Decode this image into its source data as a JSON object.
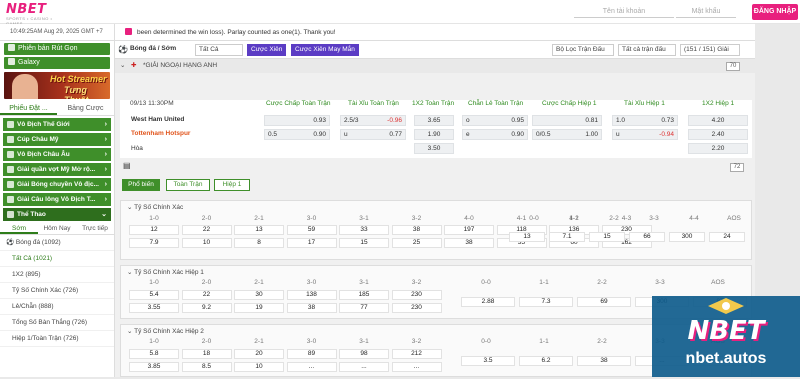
{
  "brand": {
    "logo": "NBET",
    "logo_sub": "SPORTS • CASINO • GAMES",
    "accent": "#e8207e",
    "green": "#3f8f2a"
  },
  "header": {
    "username_placeholder": "Tên tài khoản",
    "password_placeholder": "Mật khẩu",
    "login_label": "ĐĂNG NHẬP"
  },
  "sidebar": {
    "datetime": "10:49:25AM Aug 29, 2025 GMT +7",
    "buttons": [
      "Phiên bản Rút Gọn",
      "Galaxy"
    ],
    "banner": {
      "line1": "Hot Streamer",
      "line2": "Tưng Thuật"
    },
    "tabs": [
      "Phiếu Đặt ...",
      "Bảng Cược"
    ],
    "leagues": [
      "Vô Địch Thế Giới",
      "Cúp Châu Mỹ",
      "Vô Địch Châu Âu",
      "Giải quần vợt Mỹ Mở rộ...",
      "Giải Bóng chuyền Vô địc...",
      "Giải Câu lông Vô Địch T..."
    ],
    "sports_header": "Thể Thao",
    "subtabs": [
      "Sớm",
      "Hôm Nay",
      "Trực tiếp"
    ],
    "list": [
      {
        "label": "Bóng đá (1092)"
      },
      {
        "label": "Tất Cả (1021)"
      },
      {
        "label": "1X2 (895)"
      },
      {
        "label": "Tỷ Số Chính Xác (726)"
      },
      {
        "label": "Lẻ/Chẵn (888)"
      },
      {
        "label": "Tổng Số Bàn Thắng (726)"
      },
      {
        "label": "Hiệp 1/Toàn Trận (726)"
      }
    ]
  },
  "main": {
    "marquee": "been determined the win loss). Parlay counted as one(1). Thank you!",
    "filters": {
      "sport": "Bóng đá / Sớm",
      "all": "Tất Cả",
      "parlay": "Cược Xiên",
      "lucky": "Cược Xiên May Mắn",
      "league_filter": "Bộ Lọc Trận Đấu",
      "all_matches": "Tất cả trận đấu",
      "count": "(151 / 151) Giải"
    },
    "league": "*GIẢI NGOẠI HẠNG ANH",
    "league_badge": "70",
    "match": {
      "time": "09/13 11:30PM",
      "home": "West Ham United",
      "away": "Tottenham Hotspur",
      "draw": "Hòa",
      "headers": [
        "Cược Chấp Toàn Trận",
        "Tài Xỉu Toàn Trận",
        "1X2 Toàn Trận",
        "Chẵn Lẻ Toàn Trận",
        "Cược Chấp Hiệp 1",
        "Tài Xỉu Hiệp 1",
        "1X2 Hiệp 1"
      ],
      "hdp": [
        {
          "h": "",
          "o": "0.93"
        },
        {
          "h": "0.5",
          "o": "0.90"
        }
      ],
      "ou": [
        {
          "h": "2.5/3",
          "o": "-0.96"
        },
        {
          "h": "u",
          "o": "0.77"
        }
      ],
      "x12": [
        "3.65",
        "1.90",
        "3.50"
      ],
      "oe": [
        {
          "h": "o",
          "o": "0.95"
        },
        {
          "h": "e",
          "o": "0.90"
        }
      ],
      "hdp1": [
        {
          "h": "",
          "o": "0.81"
        },
        {
          "h": "0/0.5",
          "o": "1.00"
        }
      ],
      "ou1": [
        {
          "h": "1.0",
          "o": "0.73"
        },
        {
          "h": "u",
          "o": "-0.94"
        }
      ],
      "x12h1": [
        "4.20",
        "2.40",
        "2.20"
      ]
    },
    "more_badge": "72",
    "tabs": [
      "Phổ biến",
      "Toàn Trận",
      "Hiệp 1"
    ],
    "cs_full": {
      "title": "Tỷ Số Chính Xác",
      "home_heads": [
        "1-0",
        "2-0",
        "2-1",
        "3-0",
        "3-1",
        "3-2",
        "4-0",
        "4-1",
        "4-2",
        "4-3"
      ],
      "home_top": [
        "12",
        "22",
        "13",
        "59",
        "33",
        "38",
        "197",
        "118",
        "136",
        "230"
      ],
      "home_bot": [
        "7.9",
        "10",
        "8",
        "17",
        "15",
        "25",
        "38",
        "35",
        "60",
        "162"
      ],
      "draw_heads": [
        "0-0",
        "1-1",
        "2-2",
        "3-3",
        "4-4",
        "AOS"
      ],
      "draw_vals": [
        "13",
        "7.1",
        "15",
        "66",
        "300",
        "24"
      ]
    },
    "cs_h1": {
      "title": "Tỷ Số Chính Xác Hiệp 1",
      "home_heads": [
        "1-0",
        "2-0",
        "2-1",
        "3-0",
        "3-1",
        "3-2"
      ],
      "home_top": [
        "5.4",
        "22",
        "30",
        "138",
        "185",
        "230"
      ],
      "home_bot": [
        "3.55",
        "9.2",
        "19",
        "38",
        "77",
        "230"
      ],
      "draw_heads": [
        "0-0",
        "1-1",
        "2-2",
        "3-3",
        "AOS"
      ],
      "draw_vals": [
        "2.88",
        "7.3",
        "69",
        "300",
        "87"
      ]
    },
    "cs_h2": {
      "title": "Tỷ Số Chính Xác Hiệp 2",
      "home_heads": [
        "1-0",
        "2-0",
        "2-1",
        "3-0",
        "3-1",
        "3-2"
      ],
      "home_top": [
        "5.8",
        "18",
        "20",
        "89",
        "98",
        "212"
      ],
      "home_bot": [
        "3.85",
        "8.5",
        "10",
        "...",
        "...",
        "..."
      ],
      "draw_heads": [
        "0-0",
        "1-1",
        "2-2",
        "3-3",
        "AOS"
      ],
      "draw_vals": [
        "3.5",
        "6.2",
        "38",
        "...",
        "..."
      ]
    }
  },
  "watermark": {
    "logo": "NBET",
    "url": "nbet.autos"
  }
}
